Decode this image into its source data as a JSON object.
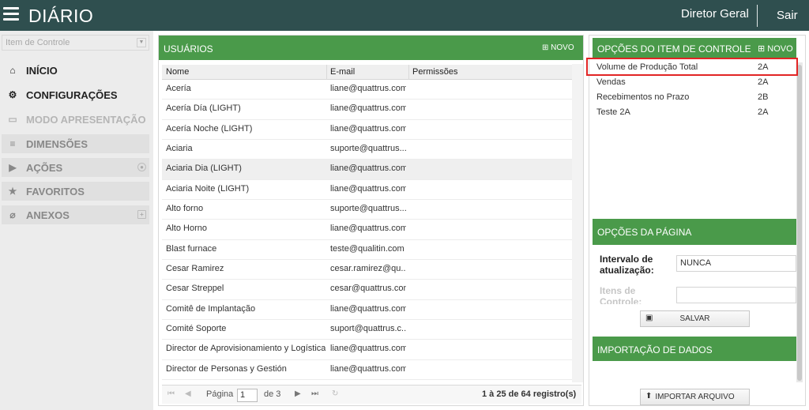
{
  "app": {
    "title": "DIÁRIO",
    "user": "Diretor Geral",
    "logout": "Sair"
  },
  "sidebar": {
    "control_placeholder": "Item de Controle",
    "items": [
      {
        "label": "INÍCIO",
        "icon": "home-icon"
      },
      {
        "label": "CONFIGURAÇÕES",
        "icon": "gear-icon"
      },
      {
        "label": "MODO APRESENTAÇÃO",
        "icon": "monitor-icon"
      },
      {
        "label": "DIMENSÕES",
        "icon": "database-icon"
      },
      {
        "label": "AÇÕES",
        "icon": "play-icon"
      },
      {
        "label": "FAVORITOS",
        "icon": "star-icon"
      },
      {
        "label": "ANEXOS",
        "icon": "paperclip-icon"
      }
    ]
  },
  "users": {
    "title": "USUÁRIOS",
    "new_label": "NOVO",
    "columns": [
      "Nome",
      "E-mail",
      "Permissões"
    ],
    "rows": [
      {
        "name": "Acería",
        "email": "liane@quattrus.com"
      },
      {
        "name": "Acería Día (LIGHT)",
        "email": "liane@quattrus.com"
      },
      {
        "name": "Acería Noche (LIGHT)",
        "email": "liane@quattrus.com"
      },
      {
        "name": "Aciaria",
        "email": "suporte@quattrus...."
      },
      {
        "name": "Aciaria Dia (LIGHT)",
        "email": "liane@quattrus.com"
      },
      {
        "name": "Aciaria Noite (LIGHT)",
        "email": "liane@quattrus.com"
      },
      {
        "name": "Alto forno",
        "email": "suporte@quattrus...."
      },
      {
        "name": "Alto Horno",
        "email": "liane@quattrus.com"
      },
      {
        "name": "Blast furnace",
        "email": "teste@qualitin.com"
      },
      {
        "name": "Cesar Ramirez",
        "email": "cesar.ramirez@qu..."
      },
      {
        "name": "Cesar Streppel",
        "email": "cesar@quattrus.com"
      },
      {
        "name": "Comitê de Implantação",
        "email": "liane@quattrus.com"
      },
      {
        "name": "Comité Soporte",
        "email": "suport@quattrus.c..."
      },
      {
        "name": "Director de Aprovisionamiento y Logística",
        "email": "liane@quattrus.com"
      },
      {
        "name": "Director de Personas y Gestión",
        "email": "liane@quattrus.com"
      }
    ],
    "pager": {
      "page_label": "Página",
      "page_value": "1",
      "of_label": "de 3",
      "summary": "1 à 25 de 64 registro(s)"
    }
  },
  "options": {
    "title": "OPÇÕES DO ITEM DE CONTROLE",
    "new_label": "NOVO",
    "items": [
      {
        "name": "Volume de Produção Total",
        "code": "2A"
      },
      {
        "name": "Vendas",
        "code": "2A"
      },
      {
        "name": "Recebimentos no Prazo",
        "code": "2B"
      },
      {
        "name": "Teste 2A",
        "code": "2A"
      }
    ]
  },
  "page_options": {
    "title": "OPÇÕES DA PÁGINA",
    "interval_label_1": "Intervalo de",
    "interval_label_2": "atualização:",
    "interval_value": "NUNCA",
    "items_label_1": "Itens de",
    "items_label_2": "Controle:",
    "save_label": "SALVAR"
  },
  "import": {
    "title": "IMPORTAÇÃO DE DADOS",
    "button_label": "IMPORTAR ARQUIVO"
  },
  "colors": {
    "topbar": "#2f4f4f",
    "panel_header": "#4a9a4a",
    "highlight": "#e22525"
  }
}
